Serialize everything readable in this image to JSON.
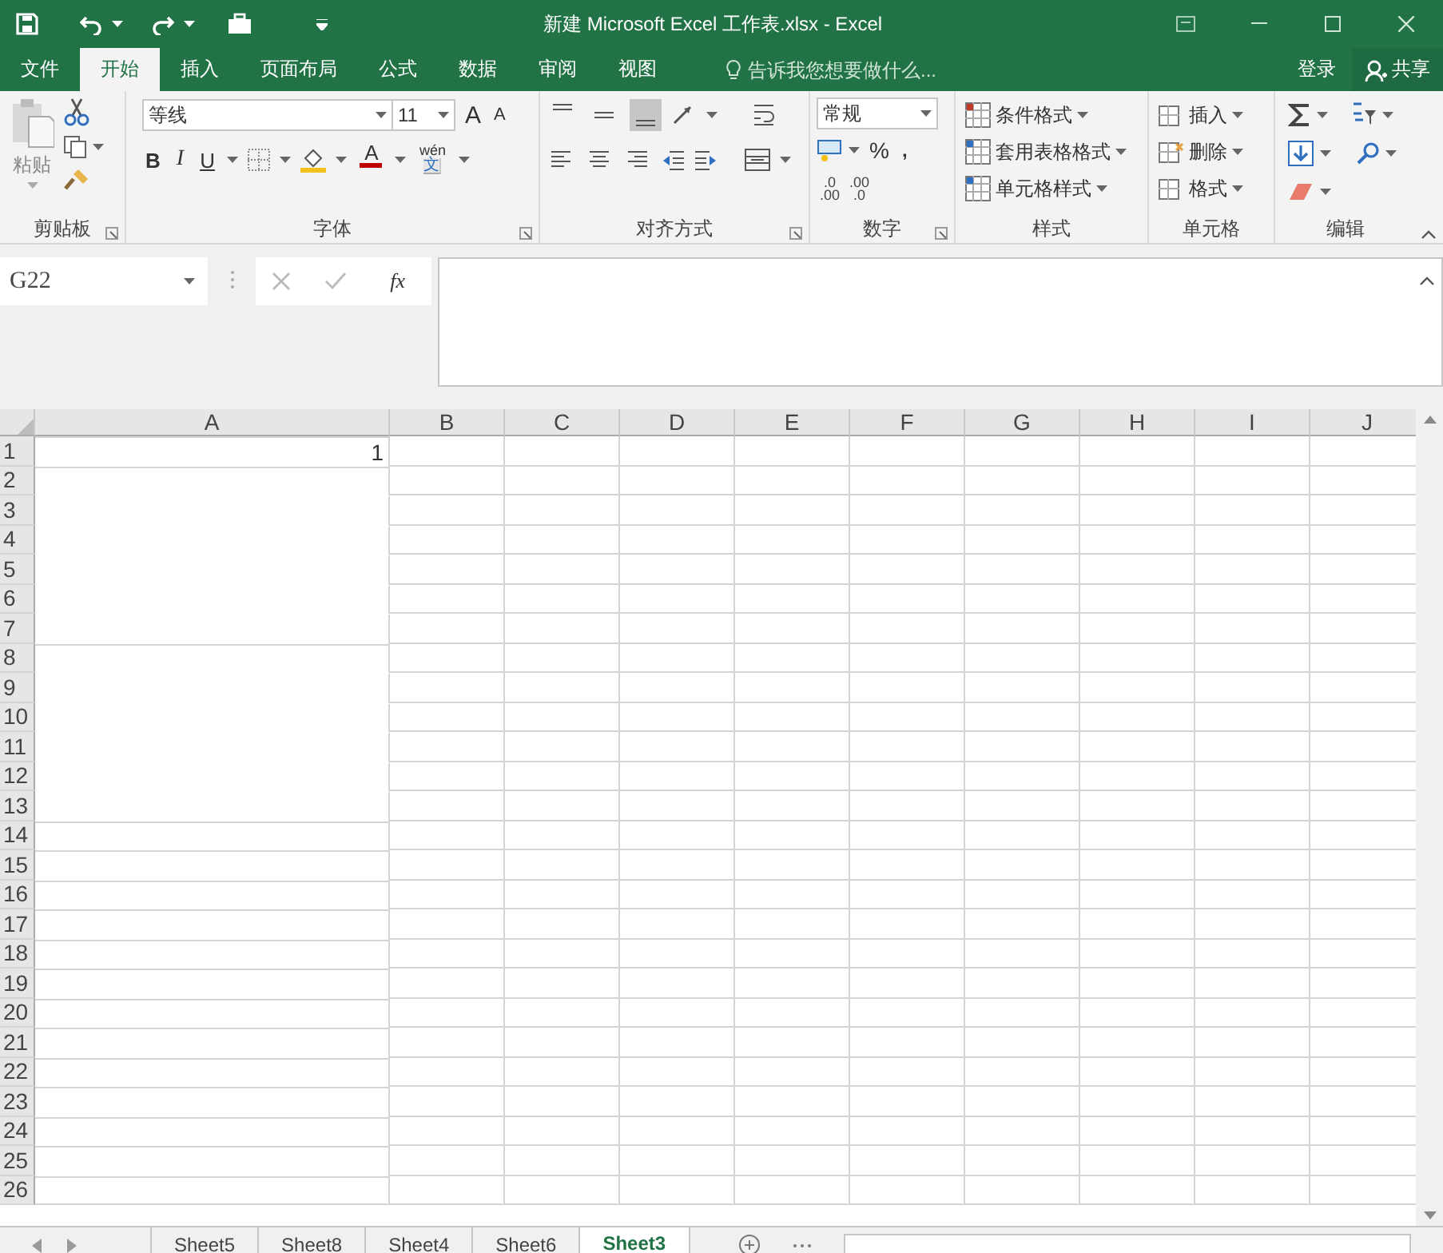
{
  "window": {
    "title": "新建 Microsoft Excel 工作表.xlsx - Excel"
  },
  "menu_tabs": [
    {
      "label": "文件",
      "selected": false
    },
    {
      "label": "开始",
      "selected": true
    },
    {
      "label": "插入",
      "selected": false
    },
    {
      "label": "页面布局",
      "selected": false
    },
    {
      "label": "公式",
      "selected": false
    },
    {
      "label": "数据",
      "selected": false
    },
    {
      "label": "审阅",
      "selected": false
    },
    {
      "label": "视图",
      "selected": false
    }
  ],
  "tell_me": {
    "placeholder": "告诉我您想要做什么..."
  },
  "account": {
    "sign_in": "登录",
    "share": "共享"
  },
  "ribbon": {
    "clipboard": {
      "label": "剪贴板",
      "paste": "粘贴"
    },
    "font": {
      "label": "字体",
      "font_name": "等线",
      "font_size": "11",
      "grow": "A",
      "shrink": "A",
      "bold": "B",
      "italic": "I",
      "underline": "U",
      "font_color": "A",
      "phonetic": "wén",
      "phonetic_char": "文"
    },
    "alignment": {
      "label": "对齐方式"
    },
    "number": {
      "label": "数字",
      "format": "常规",
      "percent": "%",
      "comma": ",",
      "decimals": [
        {
          "top": ".0",
          "bottom": ".00"
        },
        {
          "top": ".00",
          "bottom": ".0"
        }
      ]
    },
    "styles": {
      "label": "样式",
      "items": [
        "条件格式",
        "套用表格格式",
        "单元格样式"
      ]
    },
    "cells": {
      "label": "单元格",
      "items": [
        "插入",
        "删除",
        "格式"
      ]
    },
    "editing": {
      "label": "编辑"
    }
  },
  "formula_bar": {
    "name_box": "G22",
    "function_label": "fx"
  },
  "sheet": {
    "columns": [
      "A",
      "B",
      "C",
      "D",
      "E",
      "F",
      "G",
      "H",
      "I",
      "J"
    ],
    "rows": [
      {
        "label": "1",
        "a_joined_above": false,
        "a_value": "1"
      },
      {
        "label": "2",
        "a_joined_above": false
      },
      {
        "label": "3",
        "a_joined_above": true
      },
      {
        "label": "4",
        "a_joined_above": true
      },
      {
        "label": "5",
        "a_joined_above": true
      },
      {
        "label": "6",
        "a_joined_above": true
      },
      {
        "label": "7",
        "a_joined_above": true
      },
      {
        "label": "8",
        "a_joined_above": false
      },
      {
        "label": "9",
        "a_joined_above": true
      },
      {
        "label": "10",
        "a_joined_above": true
      },
      {
        "label": "11",
        "a_joined_above": true
      },
      {
        "label": "12",
        "a_joined_above": true
      },
      {
        "label": "13",
        "a_joined_above": true
      },
      {
        "label": "14",
        "a_joined_above": false
      },
      {
        "label": "15",
        "a_joined_above": false
      },
      {
        "label": "16",
        "a_joined_above": false
      },
      {
        "label": "17",
        "a_joined_above": false
      },
      {
        "label": "18",
        "a_joined_above": false
      },
      {
        "label": "19",
        "a_joined_above": false
      },
      {
        "label": "20",
        "a_joined_above": false
      },
      {
        "label": "21",
        "a_joined_above": false
      },
      {
        "label": "22",
        "a_joined_above": false
      },
      {
        "label": "23",
        "a_joined_above": false
      },
      {
        "label": "24",
        "a_joined_above": false
      },
      {
        "label": "25",
        "a_joined_above": false
      },
      {
        "label": "26",
        "a_joined_above": false
      }
    ]
  },
  "sheet_tabs": [
    {
      "label": "Sheet5",
      "selected": false
    },
    {
      "label": "Sheet8",
      "selected": false
    },
    {
      "label": "Sheet4",
      "selected": false
    },
    {
      "label": "Sheet6",
      "selected": false
    },
    {
      "label": "Sheet3",
      "selected": true
    }
  ]
}
